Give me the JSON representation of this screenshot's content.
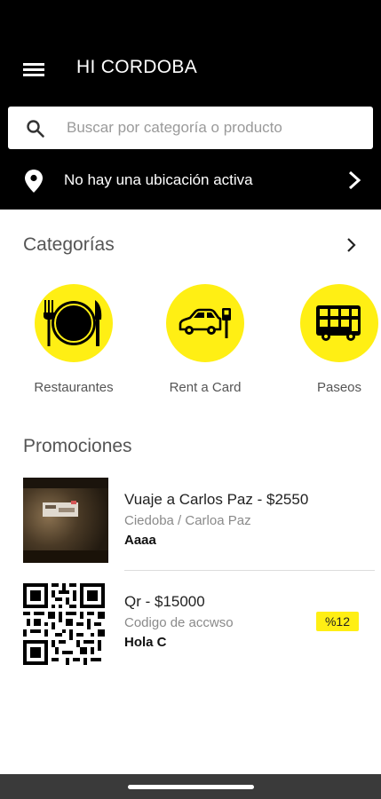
{
  "header": {
    "title": "HI CORDOBA",
    "search_placeholder": "Buscar por categoría o producto",
    "location_text": "No hay una ubicación activa"
  },
  "categories": {
    "title": "Categorías",
    "items": [
      {
        "label": "Restaurantes",
        "icon": "plate-cutlery-icon"
      },
      {
        "label": "Rent a Card",
        "icon": "car-rental-icon"
      },
      {
        "label": "Paseos",
        "icon": "bus-icon"
      }
    ]
  },
  "promotions": {
    "title": "Promociones",
    "items": [
      {
        "title": "Vuaje a Carlos Paz - $2550",
        "subtitle": "Ciedoba / Carloa Paz",
        "store": "Aaaa",
        "thumb": "dark-photo"
      },
      {
        "title": "Qr - $15000",
        "subtitle": "Codigo de accwso",
        "store": "Hola C",
        "thumb": "qr-code",
        "discount": "%12"
      }
    ]
  },
  "colors": {
    "accent": "#ffef14",
    "header_bg": "#000000",
    "navbar_bg": "#3a3a3a"
  }
}
